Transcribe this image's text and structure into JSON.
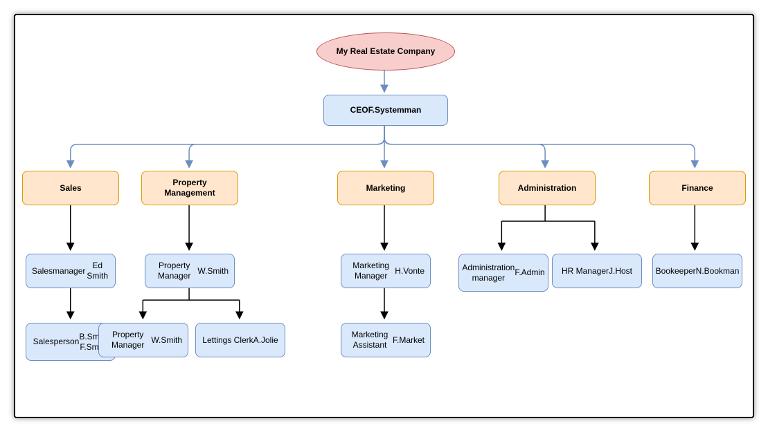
{
  "company": {
    "name": "My Real Estate Company"
  },
  "ceo": {
    "title": "CEO",
    "name": "F.Systemman"
  },
  "departments": {
    "sales": {
      "label": "Sales"
    },
    "property": {
      "label": "Property\nManagement"
    },
    "marketing": {
      "label": "Marketing"
    },
    "admin": {
      "label": "Administration"
    },
    "finance": {
      "label": "Finance"
    }
  },
  "people": {
    "salesmanager": {
      "title": "Salesmanager",
      "name": "Ed Smith"
    },
    "salesperson": {
      "title": "Salesperson",
      "name": "B.Smith\nF.Smith"
    },
    "propmanager": {
      "title": "Property Manager",
      "name": "W.Smith"
    },
    "propmanager2": {
      "title": "Property Manager",
      "name": "W.Smith"
    },
    "lettings": {
      "title": "Lettings Clerk",
      "name": "A.Jolie"
    },
    "marketingmanager": {
      "title": "Marketing Manager",
      "name": "H.Vonte"
    },
    "marketingassistant": {
      "title": "Marketing Assistant",
      "name": "F.Market"
    },
    "adminmanager": {
      "title": "Administration\nmanager",
      "name": "F.Admin"
    },
    "hrmanager": {
      "title": "HR Manager",
      "name": "J.Host"
    },
    "bookeeper": {
      "title": "Bookeeper",
      "name": "N.Bookman"
    }
  }
}
